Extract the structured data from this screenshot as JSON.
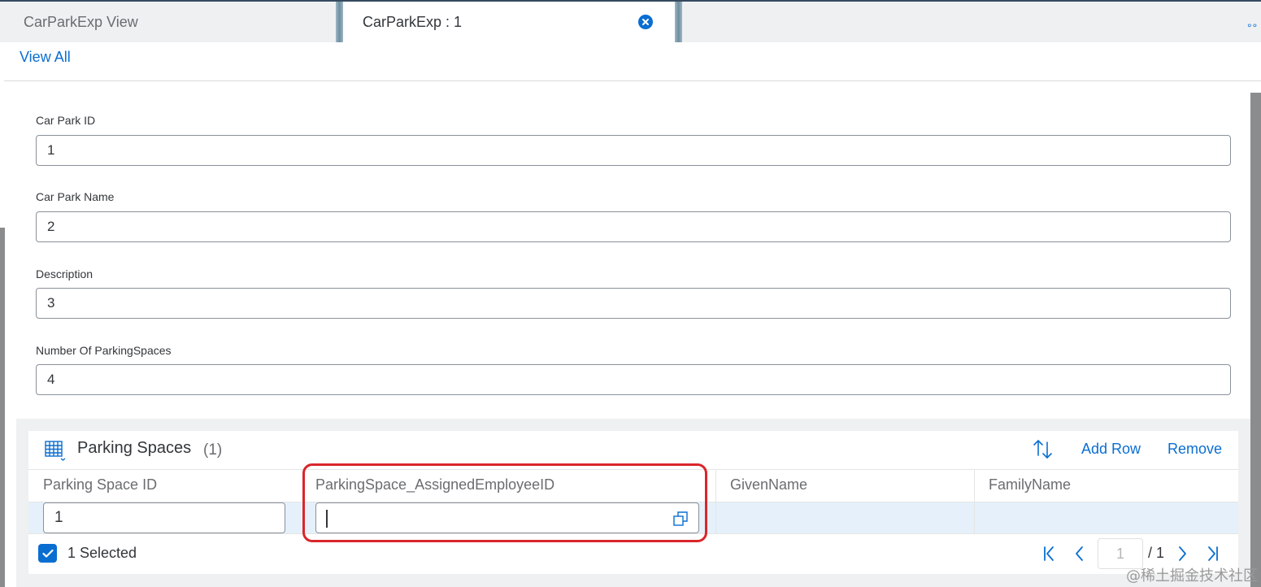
{
  "tabs": [
    {
      "label": "CarParkExp View"
    },
    {
      "label": "CarParkExp : 1"
    }
  ],
  "nav": {
    "view_all": "View All"
  },
  "form": {
    "fields": [
      {
        "label": "Car Park ID",
        "value": "1"
      },
      {
        "label": "Car Park Name",
        "value": "2"
      },
      {
        "label": "Description",
        "value": "3"
      },
      {
        "label": "Number Of ParkingSpaces",
        "value": "4"
      }
    ]
  },
  "table": {
    "title": "Parking Spaces",
    "count": "(1)",
    "add_row": "Add Row",
    "remove": "Remove",
    "columns": [
      "Parking Space ID",
      "ParkingSpace_AssignedEmployeeID",
      "GivenName",
      "FamilyName"
    ],
    "rows": [
      {
        "parking_space_id": "1",
        "assigned_employee_id": "",
        "given_name": "",
        "family_name": ""
      }
    ],
    "selected_text": "1 Selected",
    "page_input": "1",
    "page_total": "/ 1"
  },
  "watermark": "@稀土掘金技术社区",
  "colors": {
    "accent": "#0a6ed1",
    "highlight": "#d9262b"
  }
}
